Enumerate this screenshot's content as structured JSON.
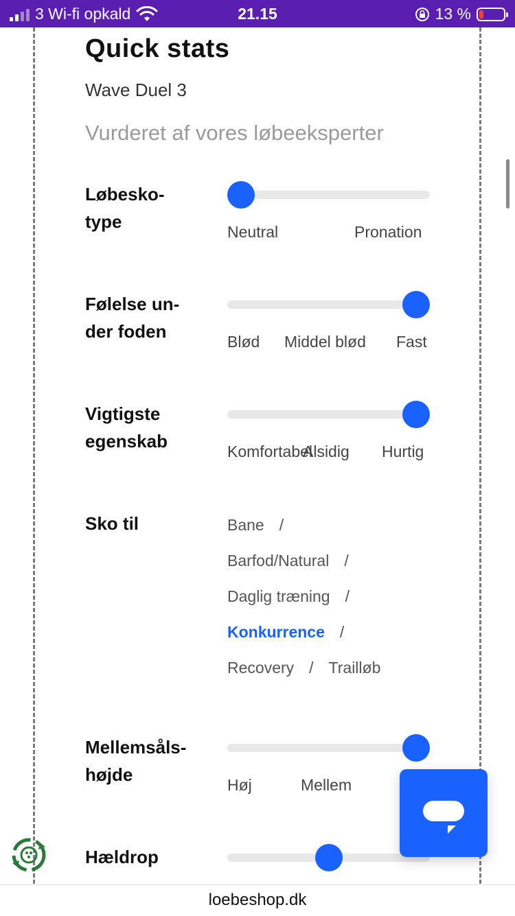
{
  "status_bar": {
    "carrier": "3 Wi-fi opkald",
    "time": "21.15",
    "battery": "13 %",
    "icons": [
      "signal-icon",
      "wifi-icon",
      "orientation-lock-icon",
      "battery-icon"
    ],
    "battery_color": "#ff3b30",
    "bg_color": "#5a1fb0"
  },
  "header": {
    "title": "Quick stats",
    "subtitle": "Wave Duel 3",
    "tagline": "Vurderet af vores løbeeksperter"
  },
  "accent_color": "#1a62ff",
  "stats": [
    {
      "label": "Løbesko-\ntype",
      "options": [
        "Neutral",
        "Pronation"
      ],
      "value": 0
    },
    {
      "label": "Følelse un-\nder foden",
      "options": [
        "Blød",
        "Middel blød",
        "Fast"
      ],
      "value": 1
    },
    {
      "label": "Vigtigste\negenskab",
      "options": [
        "Komfortabel",
        "Alsidig",
        "Hurtig"
      ],
      "value": 1
    },
    {
      "label": "Mellemsåls-\nhøjde",
      "options": [
        "Høj",
        "Mellem"
      ],
      "value": 1
    },
    {
      "label": "Hældrop",
      "value": 0.5
    }
  ],
  "sko_til": {
    "label": "Sko til",
    "items": [
      "Bane",
      "Barfod/Natural",
      "Daglig træning",
      "Konkurrence",
      "Recovery",
      "Trailløb"
    ],
    "separator": "/",
    "selected": "Konkurrence"
  },
  "chat_button": {
    "icon": "chat-icon"
  },
  "recycle_badge": {
    "icon": "recycle-icon"
  },
  "browser": {
    "url": "loebeshop.dk"
  }
}
